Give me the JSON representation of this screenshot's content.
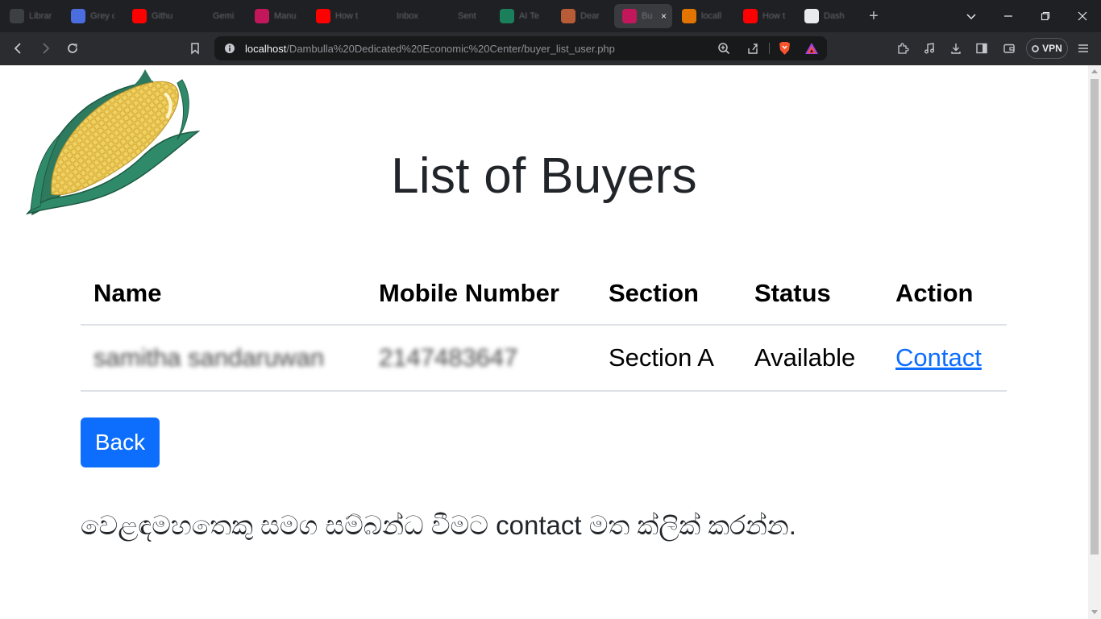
{
  "browser": {
    "tabs": [
      {
        "label": "Librar",
        "color": "#3c4043",
        "icon": "github-icon"
      },
      {
        "label": "Grey c",
        "color": "#4a6ee0",
        "icon": "globe-icon"
      },
      {
        "label": "Githu",
        "color": "#ff0000",
        "icon": "youtube-icon"
      },
      {
        "label": "Gemi",
        "color": "#1f2023",
        "icon": "gemini-icon"
      },
      {
        "label": "Manu",
        "color": "#c2185b",
        "icon": "app-icon"
      },
      {
        "label": "How t",
        "color": "#ff0000",
        "icon": "youtube-icon"
      },
      {
        "label": "Inbox",
        "color": "#1f2023",
        "icon": "gmail-icon"
      },
      {
        "label": "Sent",
        "color": "#1f2023",
        "icon": "gmail-icon"
      },
      {
        "label": "AI Te",
        "color": "#1a7f5a",
        "icon": "openai-icon"
      },
      {
        "label": "Dear",
        "color": "#b85c38",
        "icon": "app-icon"
      },
      {
        "label": "Bu",
        "color": "#c2185b",
        "icon": "app-icon",
        "active": true
      },
      {
        "label": "locall",
        "color": "#e37400",
        "icon": "server-icon"
      },
      {
        "label": "How t",
        "color": "#ff0000",
        "icon": "youtube-icon"
      },
      {
        "label": "Dash",
        "color": "#e8eaed",
        "icon": "page-icon"
      }
    ],
    "url_host": "localhost",
    "url_path": "/Dambulla%20Dedicated%20Economic%20Center/buyer_list_user.php",
    "vpn_label": "VPN"
  },
  "page": {
    "title": "List of Buyers",
    "table": {
      "headers": [
        "Name",
        "Mobile Number",
        "Section",
        "Status",
        "Action"
      ],
      "rows": [
        {
          "name": "samitha sandaruwan",
          "mobile": "2147483647",
          "section": "Section A",
          "status": "Available",
          "action": "Contact"
        }
      ]
    },
    "back_label": "Back",
    "note": "වෙළඳමහතෙකු සමග සම්බන්ධ වීමට contact මත ක්ලික් කරන්න."
  }
}
